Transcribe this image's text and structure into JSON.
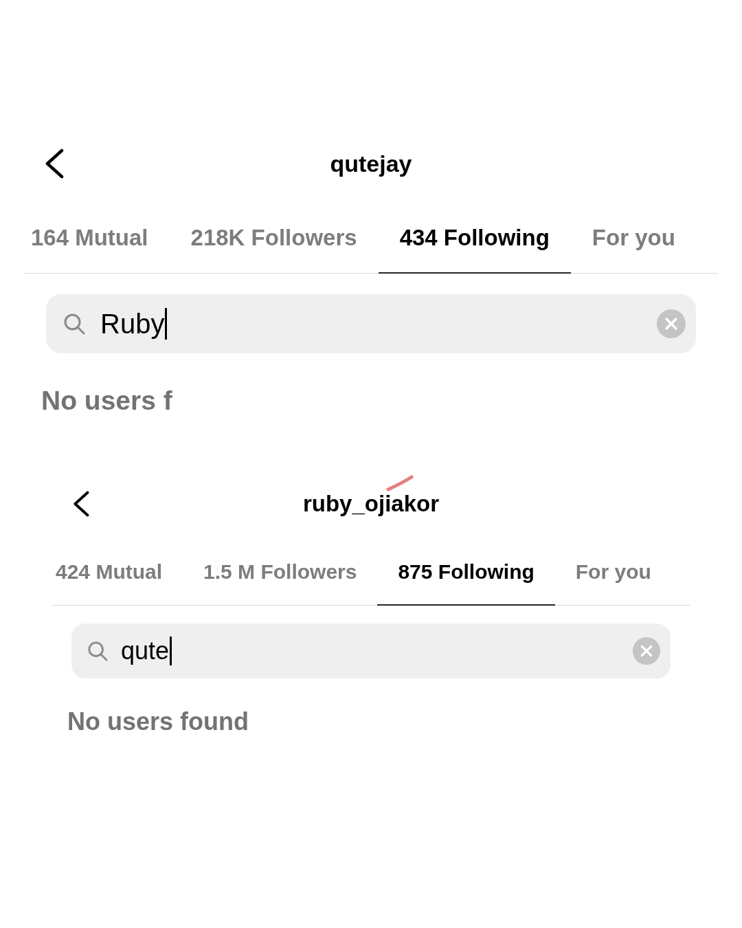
{
  "panels": [
    {
      "title": "qutejay",
      "tabs": [
        {
          "label": "164 Mutual",
          "selected": false
        },
        {
          "label": "218K Followers",
          "selected": false
        },
        {
          "label": "434 Following",
          "selected": true
        },
        {
          "label": "For you",
          "selected": false
        }
      ],
      "search": {
        "value": "Ruby",
        "focused": true
      },
      "message": "No users f"
    },
    {
      "title": "ruby_ojiakor",
      "tabs": [
        {
          "label": "424 Mutual",
          "selected": false
        },
        {
          "label": "1.5 M Followers",
          "selected": false
        },
        {
          "label": "875 Following",
          "selected": true
        },
        {
          "label": "For you",
          "selected": false
        }
      ],
      "search": {
        "value": "qute",
        "focused": true
      },
      "message": "No users found"
    }
  ]
}
